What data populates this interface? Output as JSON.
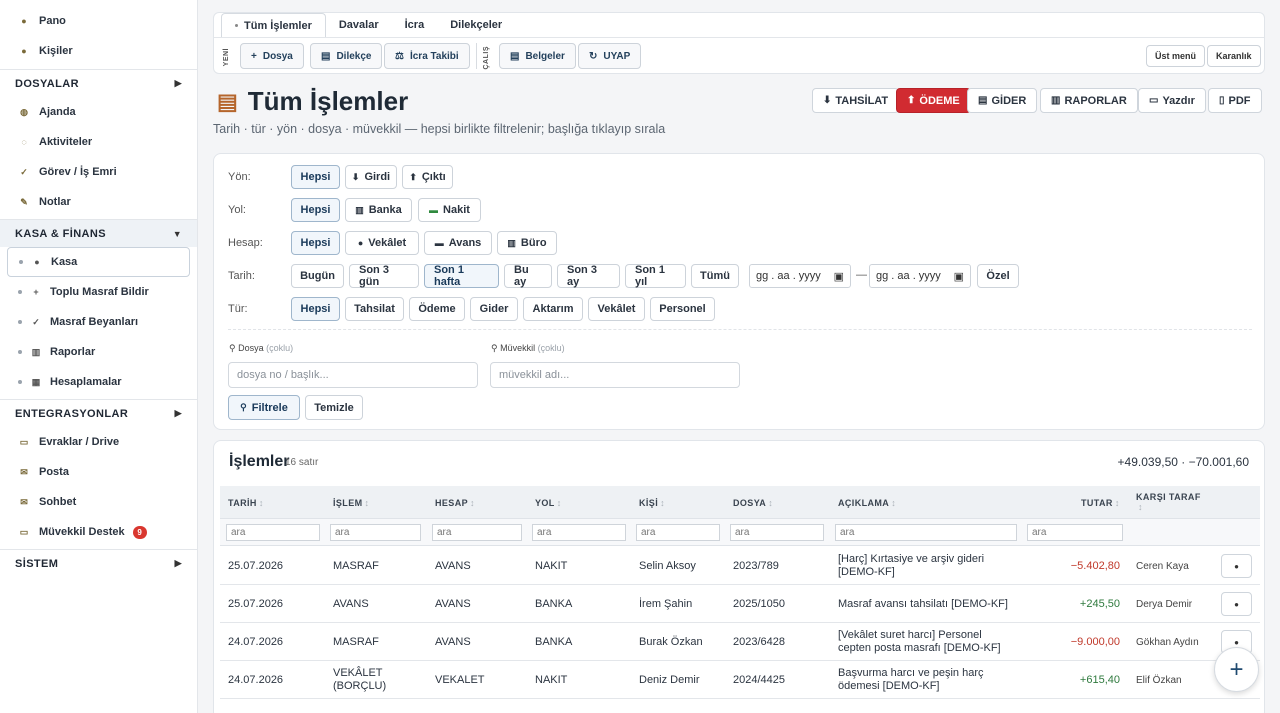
{
  "sidebar": {
    "top": [
      {
        "label": "Pano",
        "icon": "dashboard-icon"
      },
      {
        "label": "Kişiler",
        "icon": "people-icon"
      }
    ],
    "dosyalar": {
      "label": "DOSYALAR",
      "items": [
        {
          "label": "Ajanda"
        },
        {
          "label": "Aktiviteler"
        },
        {
          "label": "Görev / İş Emri"
        },
        {
          "label": "Notlar"
        }
      ]
    },
    "kasa": {
      "label": "KASA & FİNANS",
      "items": [
        {
          "label": "Kasa"
        },
        {
          "label": "Toplu Masraf Bildir"
        },
        {
          "label": "Masraf Beyanları"
        },
        {
          "label": "Raporlar"
        },
        {
          "label": "Hesaplamalar"
        }
      ]
    },
    "entegrasyonlar": {
      "label": "ENTEGRASYONLAR",
      "items": [
        {
          "label": "Evraklar / Drive"
        },
        {
          "label": "Posta"
        },
        {
          "label": "Sohbet"
        },
        {
          "label": "Müvekkil Destek",
          "badge": "9"
        }
      ]
    },
    "sistem": {
      "label": "SİSTEM"
    }
  },
  "tabs": [
    "Tüm İşlemler",
    "Davalar",
    "İcra",
    "Dilekçeler"
  ],
  "toolbar": {
    "yeni": "YENİ",
    "calis": "ÇALIŞ",
    "dosya": "Dosya",
    "dilekce": "Dilekçe",
    "icra_takibi": "İcra Takibi",
    "belgeler": "Belgeler",
    "uyap": "UYAP",
    "ust_menu": "Üst menü",
    "karanlik": "Karanlık"
  },
  "page": {
    "title": "Tüm İşlemler",
    "subtitle": "Tarih · tür · yön · dosya · müvekkil — hepsi birlikte filtrelenir; başlığa tıklayıp sırala"
  },
  "actions": {
    "tahsilat": "TAHSİLAT",
    "odeme": "ÖDEME",
    "gider": "GİDER",
    "raporlar": "RAPORLAR",
    "yazdir": "Yazdır",
    "pdf": "PDF"
  },
  "filters": {
    "yon": {
      "label": "Yön:",
      "options": [
        "Hepsi",
        "Girdi",
        "Çıktı"
      ]
    },
    "yol": {
      "label": "Yol:",
      "options": [
        "Hepsi",
        "Banka",
        "Nakit"
      ]
    },
    "hesap": {
      "label": "Hesap:",
      "options": [
        "Hepsi",
        "Vekâlet",
        "Avans",
        "Büro"
      ]
    },
    "tarih": {
      "label": "Tarih:",
      "options": [
        "Bugün",
        "Son 3 gün",
        "Son 1 hafta",
        "Bu ay",
        "Son 3 ay",
        "Son 1 yıl",
        "Tümü"
      ],
      "date_placeholder": "gg . aa . yyyy",
      "dash": "—",
      "ozel": "Özel"
    },
    "tur": {
      "label": "Tür:",
      "options": [
        "Hepsi",
        "Tahsilat",
        "Ödeme",
        "Gider",
        "Aktarım",
        "Vekâlet",
        "Personel"
      ]
    },
    "dosya": {
      "label": "Dosya",
      "hint": "(çoklu)",
      "placeholder": "dosya no / başlık..."
    },
    "muvekkil": {
      "label": "Müvekkil",
      "hint": "(çoklu)",
      "placeholder": "müvekkil adı..."
    },
    "filtrele": "Filtrele",
    "temizle": "Temizle"
  },
  "table": {
    "title": "İşlemler",
    "count": "16 satır",
    "totals": "+49.039,50 · −70.001,60",
    "columns": [
      "TARİH",
      "İŞLEM",
      "HESAP",
      "YOL",
      "KİŞİ",
      "DOSYA",
      "AÇIKLAMA",
      "TUTAR",
      "KARŞI TARAF"
    ],
    "filter_placeholder": "ara",
    "rows": [
      {
        "tarih": "25.07.2026",
        "islem": "MASRAF",
        "hesap": "AVANS",
        "yol": "NAKIT",
        "kisi": "Selin Aksoy",
        "dosya": "2023/789",
        "aciklama": "[Harç] Kırtasiye ve arşiv gideri [DEMO-KF]",
        "tutar": "−5.402,80",
        "karsi": "Ceren Kaya"
      },
      {
        "tarih": "25.07.2026",
        "islem": "AVANS",
        "hesap": "AVANS",
        "yol": "BANKA",
        "kisi": "İrem Şahin",
        "dosya": "2025/1050",
        "aciklama": "Masraf avansı tahsilatı [DEMO-KF]",
        "tutar": "+245,50",
        "karsi": "Derya Demir"
      },
      {
        "tarih": "24.07.2026",
        "islem": "MASRAF",
        "hesap": "AVANS",
        "yol": "BANKA",
        "kisi": "Burak Özkan",
        "dosya": "2023/6428",
        "aciklama": "[Vekâlet suret harcı] Personel cepten posta masrafı [DEMO-KF]",
        "tutar": "−9.000,00",
        "karsi": "Gökhan Aydın"
      },
      {
        "tarih": "24.07.2026",
        "islem": "VEKÂLET (BORÇLU)",
        "hesap": "VEKALET",
        "yol": "NAKIT",
        "kisi": "Deniz Demir",
        "dosya": "2024/4425",
        "aciklama": "Başvurma harcı ve peşin harç ödemesi [DEMO-KF]",
        "tutar": "+615,40",
        "karsi": "Elif Özkan"
      }
    ]
  }
}
